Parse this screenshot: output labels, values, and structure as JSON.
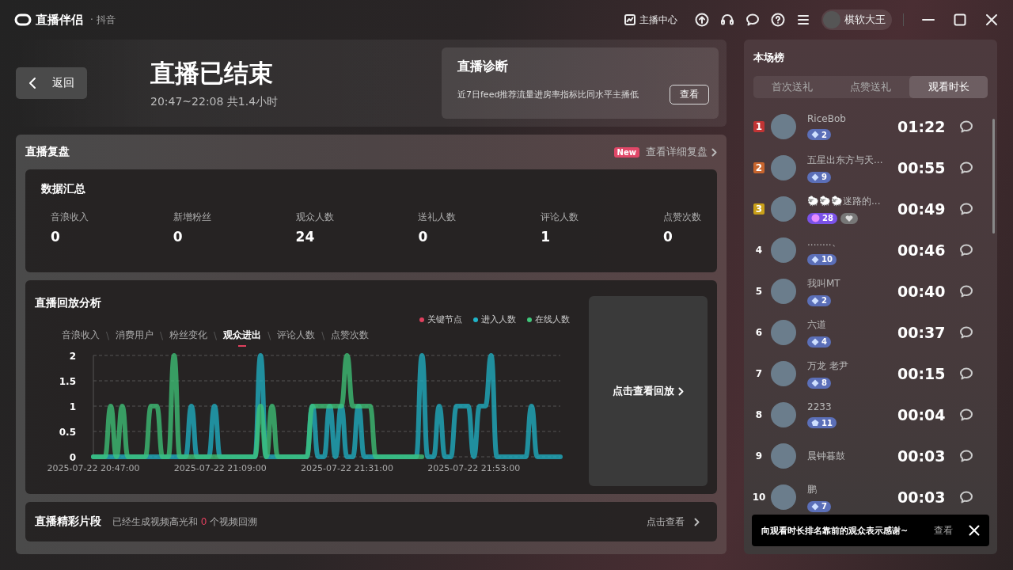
{
  "app": {
    "name": "直播伴侣",
    "platform": "· 抖音"
  },
  "toolbar": {
    "center_label": "主播中心",
    "user_name": "棋软大王"
  },
  "header": {
    "back": "返回",
    "title": "直播已结束",
    "time_range": "20:47~22:08 共1.4小时"
  },
  "diagnosis": {
    "title": "直播诊断",
    "text": "近7日feed推荐流量进房率指标比同水平主播低",
    "button": "查看"
  },
  "review": {
    "title": "直播复盘",
    "badge": "New",
    "link": "查看详细复盘"
  },
  "summary": {
    "title": "数据汇总",
    "stats": [
      {
        "label": "音浪收入",
        "value": "0"
      },
      {
        "label": "新增粉丝",
        "value": "0"
      },
      {
        "label": "观众人数",
        "value": "24"
      },
      {
        "label": "送礼人数",
        "value": "0"
      },
      {
        "label": "评论人数",
        "value": "1"
      },
      {
        "label": "点赞次数",
        "value": "0"
      }
    ]
  },
  "analysis": {
    "title": "直播回放分析",
    "key_node": {
      "label": "关键节点",
      "color": "#e0405e"
    },
    "tab_separator": "\\",
    "tabs": [
      {
        "label": "音浪收入",
        "selected": false
      },
      {
        "label": "消费用户",
        "selected": false
      },
      {
        "label": "粉丝变化",
        "selected": false
      },
      {
        "label": "观众进出",
        "selected": true
      },
      {
        "label": "评论人数",
        "selected": false
      },
      {
        "label": "点赞次数",
        "selected": false
      }
    ],
    "chart_data": {
      "type": "line",
      "grid": true,
      "ylim": [
        0,
        2
      ],
      "yticks": [
        0,
        0.5,
        1,
        1.5,
        2
      ],
      "categories": [
        "2025-07-22 20:47:00",
        null,
        null,
        null,
        null,
        null,
        null,
        null,
        null,
        null,
        null,
        null,
        null,
        null,
        null,
        null,
        null,
        null,
        null,
        null,
        null,
        null,
        "2025-07-22 21:09:00",
        null,
        null,
        null,
        null,
        null,
        null,
        null,
        null,
        null,
        null,
        null,
        null,
        null,
        null,
        null,
        null,
        null,
        null,
        null,
        null,
        null,
        "2025-07-22 21:31:00",
        null,
        null,
        null,
        null,
        null,
        null,
        null,
        null,
        null,
        null,
        null,
        null,
        null,
        null,
        null,
        null,
        null,
        null,
        null,
        null,
        null,
        "2025-07-22 21:53:00",
        null,
        null,
        null,
        null,
        null,
        null,
        null,
        null,
        null,
        null,
        null,
        null,
        null,
        null,
        null
      ],
      "series": [
        {
          "name": "进入人数",
          "color": "#1fb4c8",
          "values": [
            0,
            0,
            0,
            0,
            0,
            0,
            0,
            0,
            0,
            0,
            0,
            0,
            0,
            0,
            0,
            0,
            0,
            1,
            0,
            0,
            0,
            1,
            0,
            0,
            0,
            0,
            0,
            0,
            0,
            2,
            0,
            0,
            0,
            0,
            0,
            0,
            0,
            0,
            1,
            0,
            0,
            1,
            0,
            1,
            0,
            0,
            1,
            0,
            0,
            0,
            0,
            0,
            0,
            0,
            0,
            0,
            0,
            2,
            0,
            0,
            1,
            0,
            0,
            1,
            1,
            1,
            0,
            1,
            1,
            2,
            0,
            0,
            0,
            0,
            0,
            0,
            1,
            0,
            0,
            0,
            0,
            0
          ]
        },
        {
          "name": "在线人数",
          "color": "#3fc77a",
          "values": [
            0,
            0,
            0,
            1,
            0,
            1,
            0,
            0,
            0,
            0,
            1,
            1,
            0,
            0,
            2,
            0,
            0,
            0,
            0,
            0,
            0,
            0,
            0,
            0,
            0,
            0,
            0,
            0,
            0,
            1,
            0,
            1,
            0,
            0,
            0,
            0,
            0,
            0,
            1,
            1,
            1,
            1,
            1,
            1,
            2,
            1,
            1,
            1,
            1,
            0,
            0,
            0,
            0,
            0,
            0,
            0,
            0,
            0,
            null,
            null,
            null,
            null,
            null,
            null,
            null,
            null,
            null,
            null,
            null,
            null,
            null,
            null,
            null,
            null,
            null,
            null,
            null,
            null,
            null,
            null,
            null,
            null
          ]
        }
      ]
    },
    "replay": "点击查看回放"
  },
  "clips": {
    "title": "直播精彩片段",
    "text_before": "已经生成视频高光和",
    "count": "0",
    "text_after": "个视频回溯",
    "link": "点击查看"
  },
  "leaderboard": {
    "title": "本场榜",
    "tabs": [
      {
        "label": "首次送礼",
        "selected": false
      },
      {
        "label": "点赞送礼",
        "selected": false
      },
      {
        "label": "观看时长",
        "selected": true
      }
    ],
    "rows": [
      {
        "rank": "1",
        "name": "RiceBob",
        "badges": [
          {
            "kind": "diamond",
            "text": "2"
          }
        ],
        "time": "01:22"
      },
      {
        "rank": "2",
        "name": "五星出东方与天...",
        "badges": [
          {
            "kind": "diamond",
            "text": "9"
          }
        ],
        "time": "00:55"
      },
      {
        "rank": "3",
        "name": "🐑🐑🐑迷路的...",
        "badges": [
          {
            "kind": "orb",
            "text": "28"
          },
          {
            "kind": "heart"
          }
        ],
        "time": "00:49"
      },
      {
        "rank": "4",
        "name": "........、",
        "badges": [
          {
            "kind": "diamond",
            "text": "10"
          }
        ],
        "time": "00:46"
      },
      {
        "rank": "5",
        "name": "我叫MT",
        "badges": [
          {
            "kind": "diamond",
            "text": "2"
          }
        ],
        "time": "00:40"
      },
      {
        "rank": "6",
        "name": "六道",
        "badges": [
          {
            "kind": "diamond",
            "text": "4"
          }
        ],
        "time": "00:37"
      },
      {
        "rank": "7",
        "name": "万龙 老尹",
        "badges": [
          {
            "kind": "diamond",
            "text": "8"
          }
        ],
        "time": "00:15"
      },
      {
        "rank": "8",
        "name": "2233",
        "badges": [
          {
            "kind": "pentagon",
            "text": "11"
          }
        ],
        "time": "00:04"
      },
      {
        "rank": "9",
        "name": "晨钟暮鼓",
        "badges": [],
        "time": "00:03"
      },
      {
        "rank": "10",
        "name": "鹏",
        "badges": [
          {
            "kind": "diamond",
            "text": "7"
          }
        ],
        "time": "00:03"
      }
    ],
    "toast": {
      "text": "向观看时长排名靠前的观众表示感谢~",
      "action": "查看"
    }
  }
}
